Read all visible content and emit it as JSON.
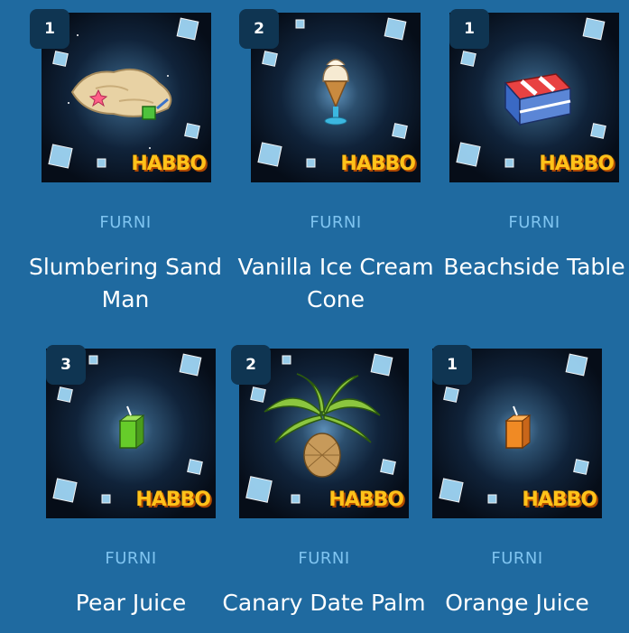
{
  "brand_logo": "HABBO",
  "items": [
    {
      "quantity": "1",
      "type": "FURNI",
      "name": "Slumbering Sand Man",
      "icon": "sand-man-icon"
    },
    {
      "quantity": "2",
      "type": "FURNI",
      "name": "Vanilla Ice Cream Cone",
      "icon": "ice-cream-icon"
    },
    {
      "quantity": "1",
      "type": "FURNI",
      "name": "Beachside Table",
      "icon": "beach-table-icon"
    },
    {
      "quantity": "3",
      "type": "FURNI",
      "name": "Pear Juice",
      "icon": "pear-juice-icon"
    },
    {
      "quantity": "2",
      "type": "FURNI",
      "name": "Canary Date Palm",
      "icon": "palm-tree-icon"
    },
    {
      "quantity": "1",
      "type": "FURNI",
      "name": "Orange Juice",
      "icon": "orange-juice-icon"
    }
  ],
  "colors": {
    "background": "#1f6aa0",
    "badge": "#0f3552",
    "type_label": "#7fc4f0",
    "logo": "#ffc21a"
  }
}
